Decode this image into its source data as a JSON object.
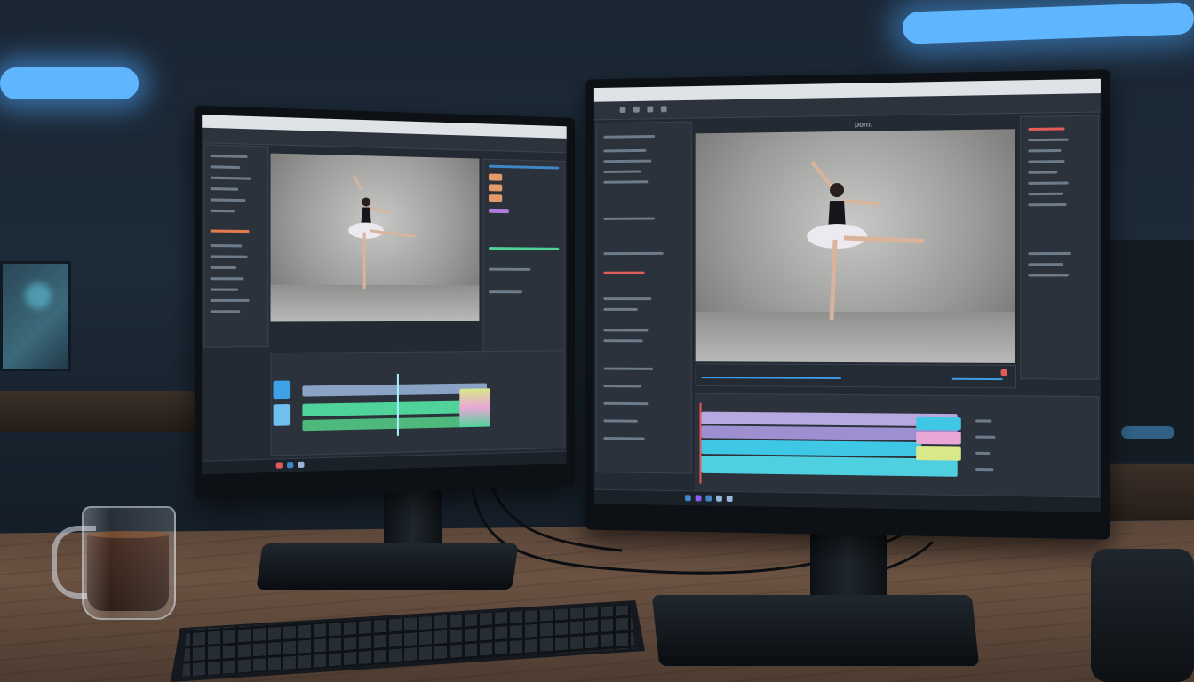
{
  "scene": {
    "left_monitor": {
      "app": "video-editor",
      "preview": "ballet-dancer-arabesque",
      "timeline_tracks": [
        "blue",
        "lavender",
        "green",
        "pink"
      ]
    },
    "right_monitor": {
      "app": "video-editor",
      "panel_title": "pom.",
      "preview": "ballet-dancer-arabesque",
      "timeline_tracks": [
        "lavender",
        "cyan",
        "green"
      ]
    },
    "desk_items": [
      "coffee-mug",
      "keyboard",
      "speaker"
    ],
    "colors": {
      "ambient_light": "#5fb6ff",
      "desk": "#6b5242",
      "editor_bg": "#232a33",
      "track_blue": "#3fc7e6",
      "track_lavender": "#b8a8e0",
      "track_green": "#4fd39a",
      "track_pink": "#e9a7d6",
      "track_yellow": "#d8e88a"
    }
  }
}
